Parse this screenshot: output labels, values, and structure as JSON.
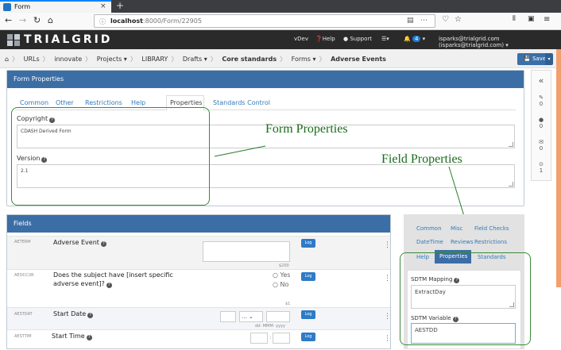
{
  "browser": {
    "tab_title": "Form",
    "url_host": "localhost",
    "url_path": ":8000/Form/22905"
  },
  "app": {
    "brand": "TRIALGRID",
    "menu": {
      "vdev": "vDev",
      "help": "Help",
      "support": "Support",
      "notifications": "4",
      "user": "isparks@trialgrid.com (isparks@trialgrid.com)"
    }
  },
  "breadcrumb": [
    "URLs",
    "innovate",
    "Projects",
    "LIBRARY",
    "Drafts",
    "Core standards",
    "Forms",
    "Adverse Events"
  ],
  "save_label": "Save",
  "form_properties": {
    "title": "Form Properties",
    "tabs": [
      "Common",
      "Other",
      "Restrictions",
      "Help",
      "Properties",
      "Standards Control"
    ],
    "copyright_label": "Copyright",
    "copyright_value": "CDASH Derived Form",
    "version_label": "Version",
    "version_value": "2.1"
  },
  "annotations": {
    "form": "Form  Properties",
    "field": "Field  Properties"
  },
  "fields": {
    "title": "Fields",
    "log_label": "Log",
    "rows": [
      {
        "code": "AETERM",
        "label": "Adverse Event",
        "counter": "$200"
      },
      {
        "code": "AEOCCUR",
        "label_line1": "Does the subject have [insert specific",
        "label_line2": "adverse event]?",
        "yes": "Yes",
        "no": "No",
        "counter": "$1"
      },
      {
        "code": "AESTDAT",
        "label": "Start Date",
        "select_value": "...",
        "date_format": "dd- MMM- yyyy"
      },
      {
        "code": "AESTTIM",
        "label": "Start Time"
      }
    ]
  },
  "side_panel": {
    "tabs_row1": [
      "Common",
      "Misc",
      "Field Checks"
    ],
    "tabs_row2": [
      "DateTime",
      "Reviews",
      "Restrictions"
    ],
    "tabs_row3": [
      "Help",
      "Properties",
      "Standards"
    ],
    "sdtm_mapping_label": "SDTM Mapping",
    "sdtm_mapping_value": "ExtractDay",
    "sdtm_variable_label": "SDTM Variable",
    "sdtm_variable_value": "AESTDD"
  },
  "rail": {
    "collapse": "«",
    "counts": [
      "0",
      "0",
      "0",
      "1"
    ]
  }
}
